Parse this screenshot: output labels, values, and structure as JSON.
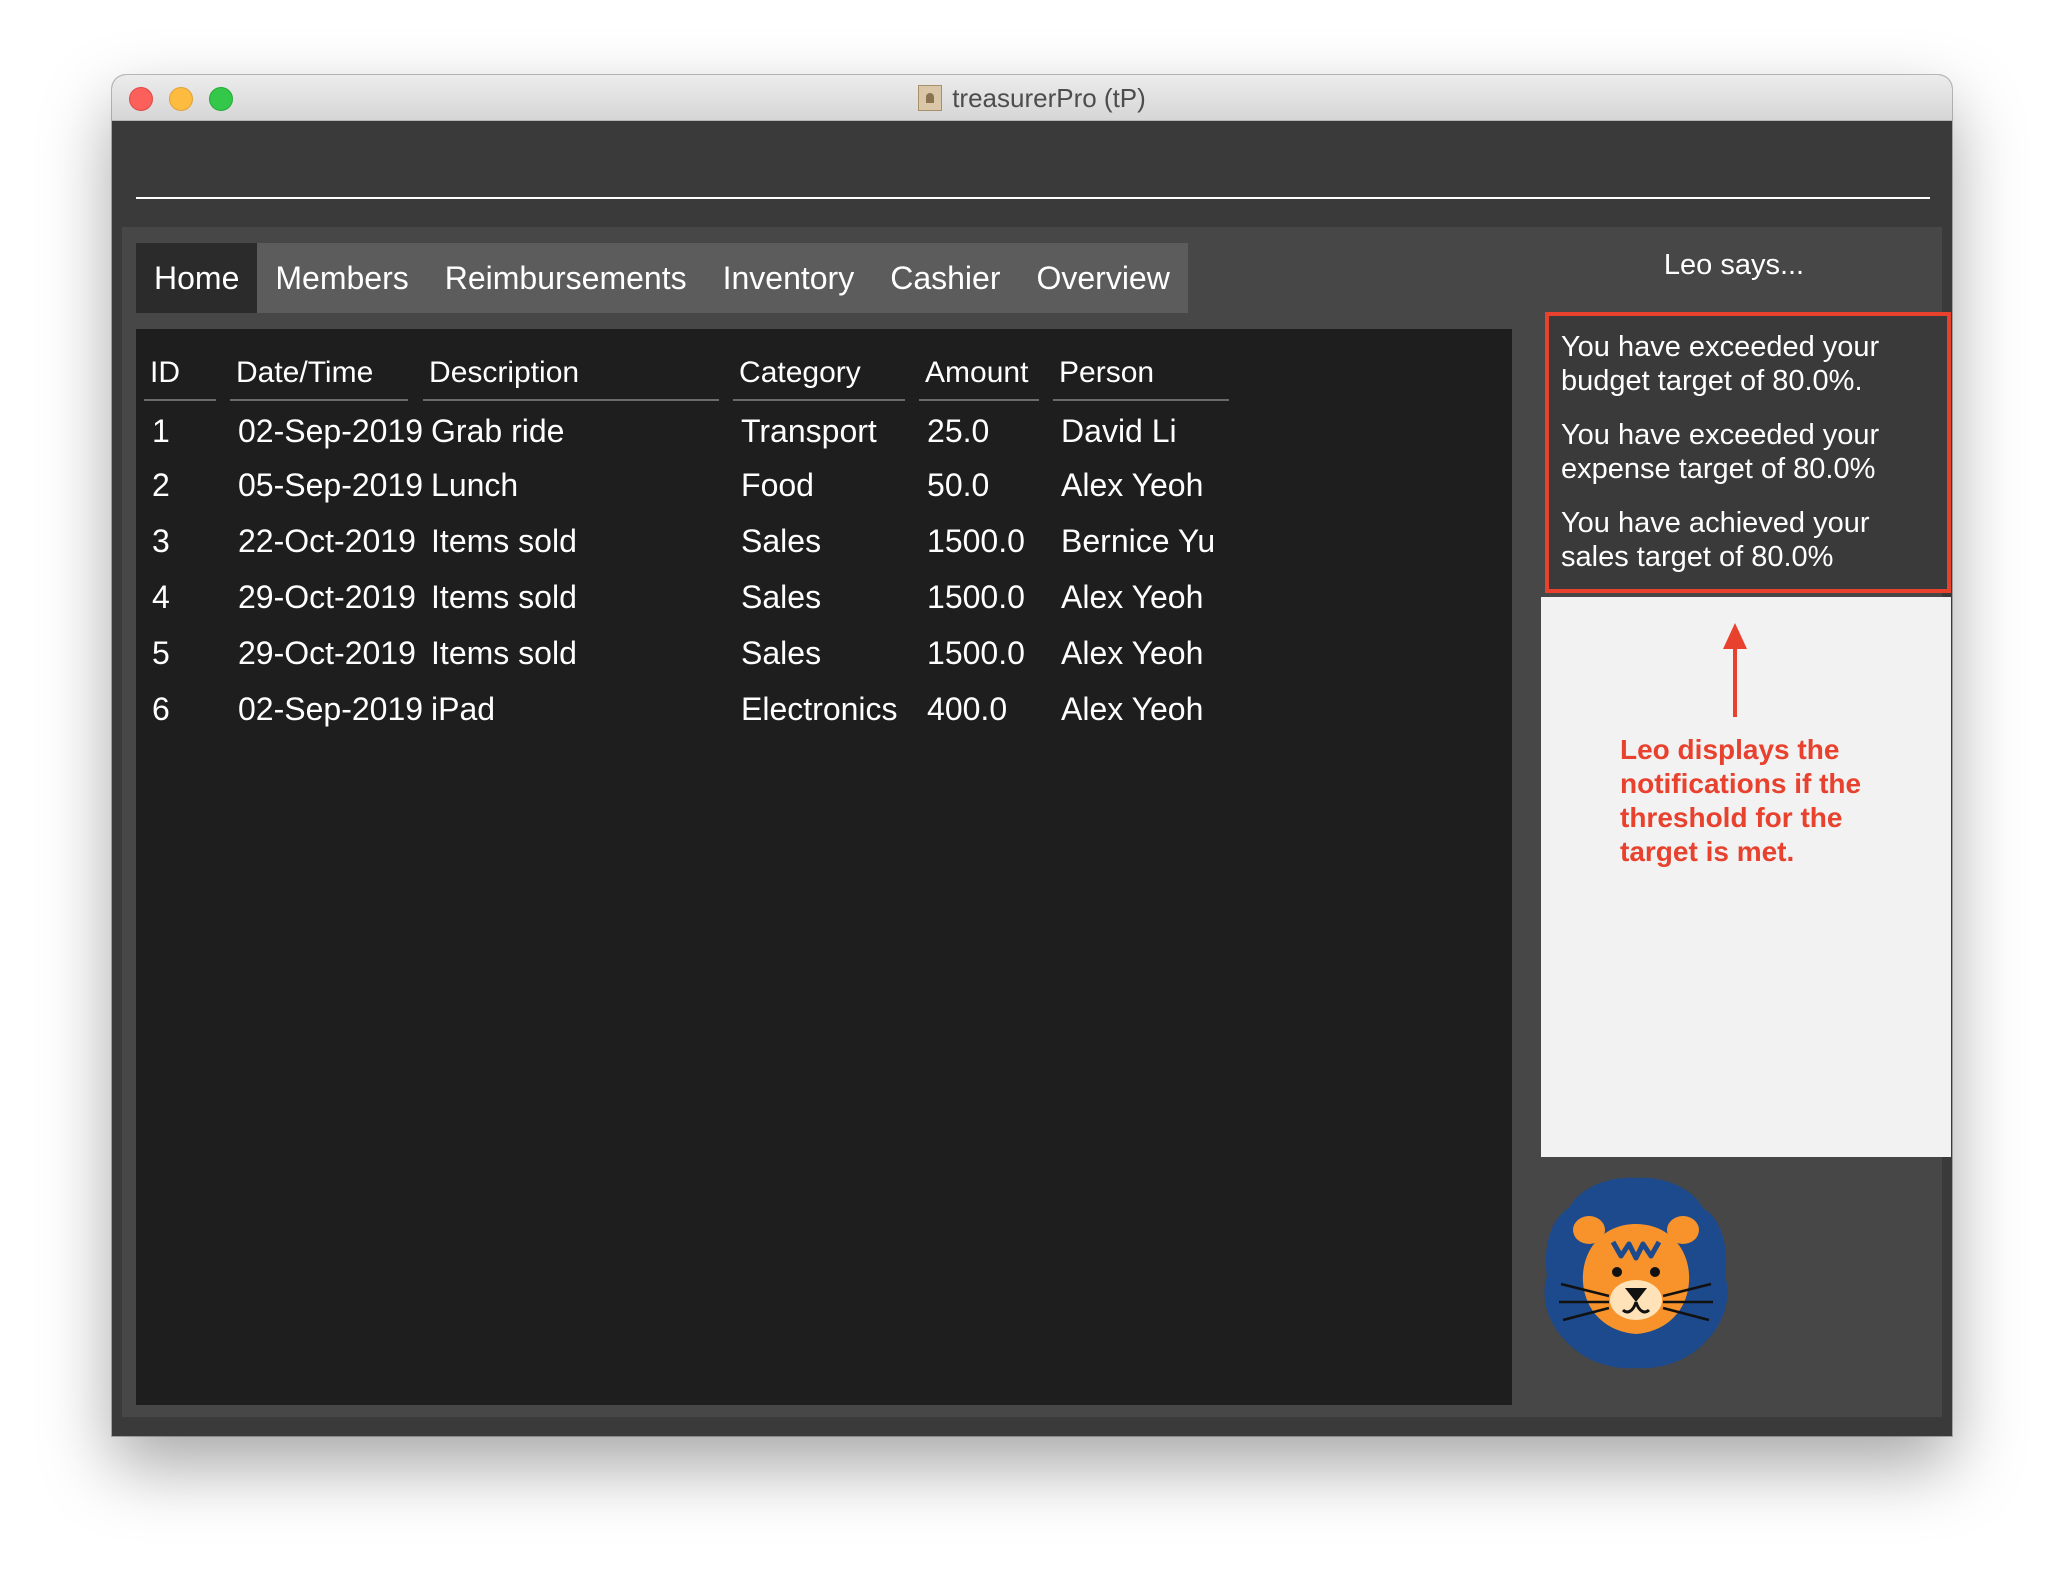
{
  "window": {
    "title": "treasurerPro (tP)"
  },
  "command": {
    "value": ""
  },
  "tabs": [
    {
      "label": "Home",
      "active": true
    },
    {
      "label": "Members",
      "active": false
    },
    {
      "label": "Reimbursements",
      "active": false
    },
    {
      "label": "Inventory",
      "active": false
    },
    {
      "label": "Cashier",
      "active": false
    },
    {
      "label": "Overview",
      "active": false
    }
  ],
  "table": {
    "headers": [
      "ID",
      "Date/Time",
      "Description",
      "Category",
      "Amount",
      "Person"
    ],
    "rows": [
      [
        "1",
        "02-Sep-2019",
        "Grab ride",
        "Transport",
        "25.0",
        "David Li"
      ],
      [
        "2",
        "05-Sep-2019",
        "Lunch",
        "Food",
        "50.0",
        "Alex Yeoh"
      ],
      [
        "3",
        "22-Oct-2019",
        "Items sold",
        "Sales",
        "1500.0",
        "Bernice Yu"
      ],
      [
        "4",
        "29-Oct-2019",
        "Items sold",
        "Sales",
        "1500.0",
        "Alex Yeoh"
      ],
      [
        "5",
        "29-Oct-2019",
        "Items sold",
        "Sales",
        "1500.0",
        "Alex Yeoh"
      ],
      [
        "6",
        "02-Sep-2019",
        "iPad",
        "Electronics",
        "400.0",
        "Alex Yeoh"
      ]
    ]
  },
  "leo": {
    "title": "Leo says...",
    "notifications": [
      "You have exceeded your budget target of 80.0%.",
      "You have exceeded your expense target of 80.0%",
      "You have achieved your sales target of 80.0%"
    ],
    "annotation": "Leo displays the notifications if the threshold for the target is met."
  },
  "colors": {
    "accent": "#e8412d",
    "lion_mane": "#1d4a8c",
    "lion_face": "#f7932a"
  }
}
